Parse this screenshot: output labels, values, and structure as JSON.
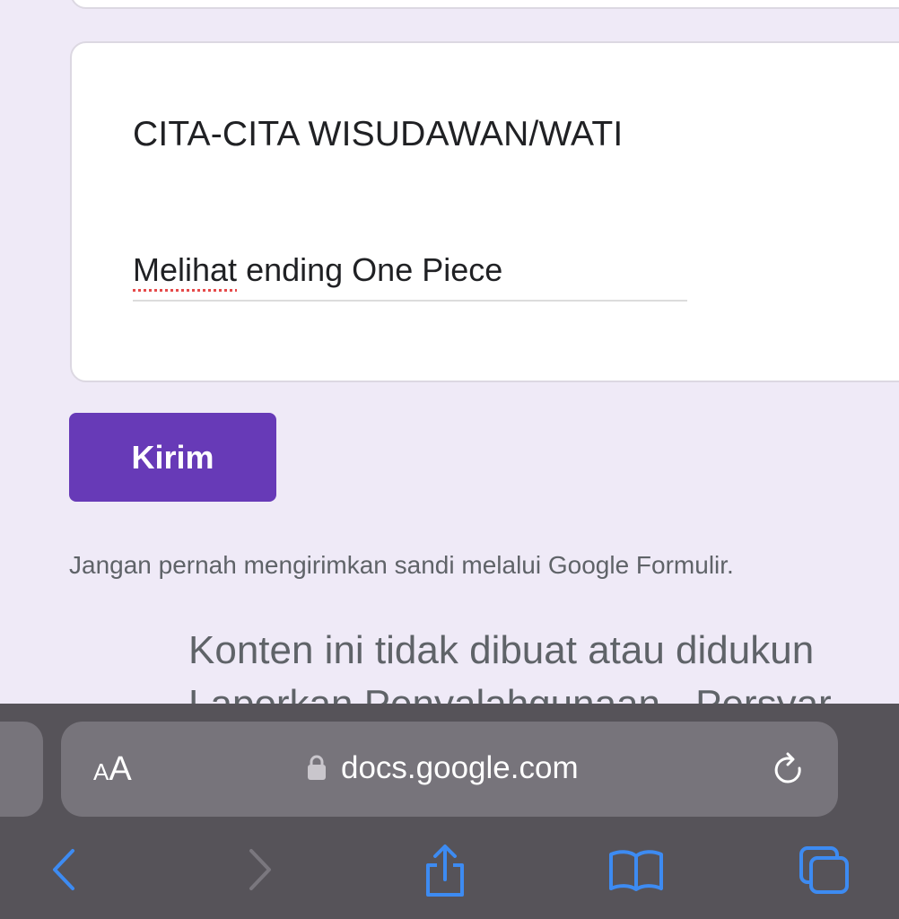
{
  "form": {
    "question_title": "CITA-CITA WISUDAWAN/WATI",
    "answer_misspelled": "Melihat",
    "answer_rest": " ending One Piece",
    "submit_label": "Kirim",
    "warning": "Jangan pernah mengirimkan sandi melalui Google Formulir.",
    "footer_line1": "Konten ini tidak dibuat atau didukun",
    "footer_line2": "Laporkan Penyalahgunaan - Persyar"
  },
  "browser": {
    "text_size_small": "A",
    "text_size_big": "A",
    "url": "docs.google.com",
    "icons": [
      "lock-icon",
      "reload-icon",
      "back-icon",
      "forward-icon",
      "share-icon",
      "bookmarks-icon",
      "tabs-icon"
    ]
  },
  "colors": {
    "background": "#efeaf7",
    "accent": "#673ab7",
    "toolbar": "#565359",
    "icon_blue": "#3d8bf2"
  }
}
